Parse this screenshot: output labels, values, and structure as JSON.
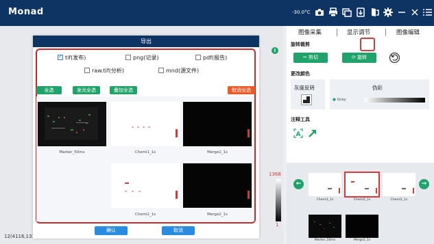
{
  "app": {
    "title": "Monad",
    "temperature": "-30.0°C"
  },
  "titlebar_icons": [
    "camera-icon",
    "printer-icon",
    "copy-icon",
    "export-icon",
    "door-exit-icon",
    "settings-icon",
    "minimize-icon",
    "close-icon",
    "menu-icon"
  ],
  "dialog": {
    "title": "导出",
    "formats": [
      {
        "label": "tif(发布)",
        "checked": true
      },
      {
        "label": "png(记录)",
        "checked": false
      },
      {
        "label": "pdf(报告)",
        "checked": false
      },
      {
        "label": "raw.tif(分析)",
        "checked": false
      },
      {
        "label": "mnd(源文件)",
        "checked": false
      }
    ],
    "select_all": "全选",
    "select_glow": "发光全选",
    "select_overlay": "叠加全选",
    "deselect_all": "取消全选",
    "thumbnails": [
      {
        "label": "Marker_50ms",
        "kind": "dark-marker"
      },
      {
        "label": "Chemi1_1s",
        "kind": "light-dots"
      },
      {
        "label": "Merge1_1s",
        "kind": "dark"
      },
      {
        "label": "Chemi2_1s",
        "kind": "light-dots2"
      },
      {
        "label": "Merge2_1s",
        "kind": "dark"
      }
    ],
    "confirm": "确认",
    "cancel": "取消"
  },
  "canvas": {
    "status": "12(4116,1337)",
    "hist_max": "1368",
    "hist_min": "1"
  },
  "right_panel": {
    "tabs": [
      "图像采集",
      "显示调节",
      "图像编辑"
    ],
    "active_tab": "图像编辑",
    "rotate_crop": {
      "title": "旋转裁剪",
      "crop": "剪切",
      "rotate": "旋转"
    },
    "change_color": {
      "title": "更改颜色",
      "invert": "灰度反转",
      "pseudo": "伪彩",
      "colormap": "Gray"
    },
    "annotation": {
      "title": "注释工具"
    }
  },
  "filmstrip": {
    "row1": [
      "Chemi1_1s",
      "Chemi2_1s",
      "Chemi1_1s"
    ],
    "row2": [
      "Marker_50ms",
      "Merge2_1s"
    ],
    "selected": "Chemi2_1s"
  },
  "colors": {
    "navy": "#0e3463",
    "green": "#1fa36a",
    "red": "#c8282a",
    "orange": "#ef5a2a",
    "blue": "#2a8ce0"
  }
}
